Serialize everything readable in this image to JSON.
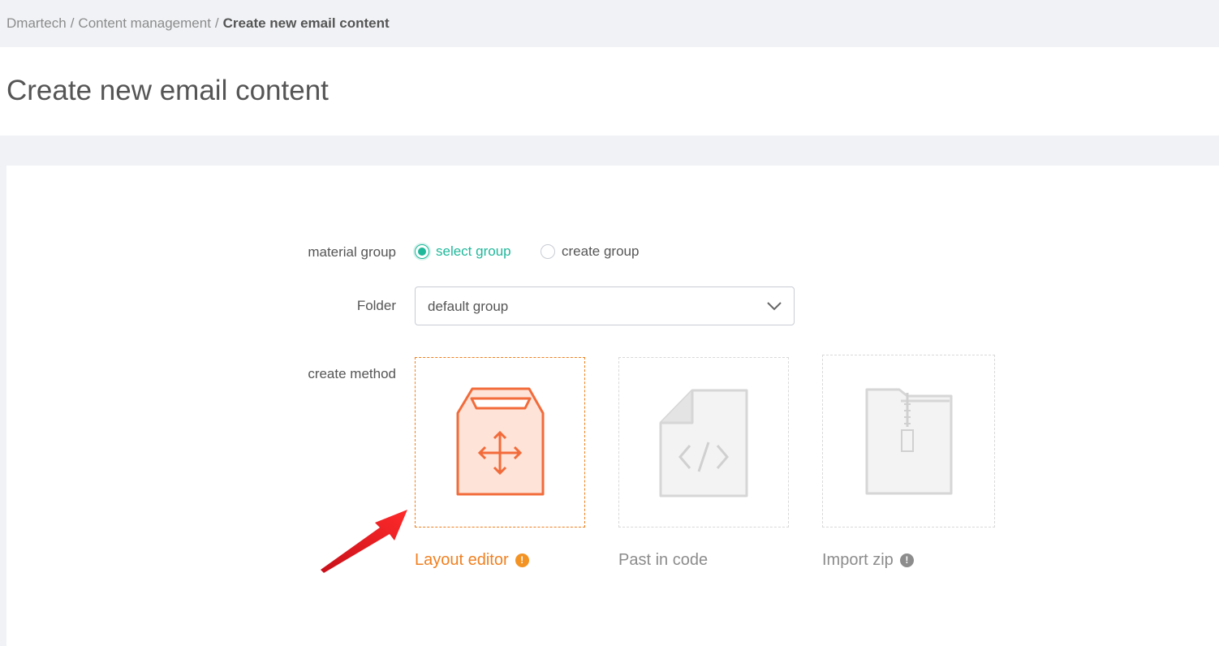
{
  "breadcrumb": {
    "items": [
      "Dmartech",
      "Content management",
      "Create new email content"
    ],
    "separator": "/"
  },
  "page": {
    "title": "Create new email content"
  },
  "form": {
    "material_group_label": "material group",
    "radio_options": [
      {
        "label": "select group",
        "checked": true
      },
      {
        "label": "create group",
        "checked": false
      }
    ],
    "folder_label": "Folder",
    "folder_value": "default group",
    "create_method_label": "create method",
    "methods": [
      {
        "label": "Layout editor",
        "icon": "layout-box-icon",
        "selected": true,
        "info": "!"
      },
      {
        "label": "Past in code",
        "icon": "code-file-icon",
        "selected": false
      },
      {
        "label": "Import zip",
        "icon": "zip-file-icon",
        "selected": false,
        "info": "!"
      }
    ]
  },
  "colors": {
    "accent_green": "#20b89a",
    "accent_orange": "#f08020",
    "annotation_red": "#e8141c"
  }
}
